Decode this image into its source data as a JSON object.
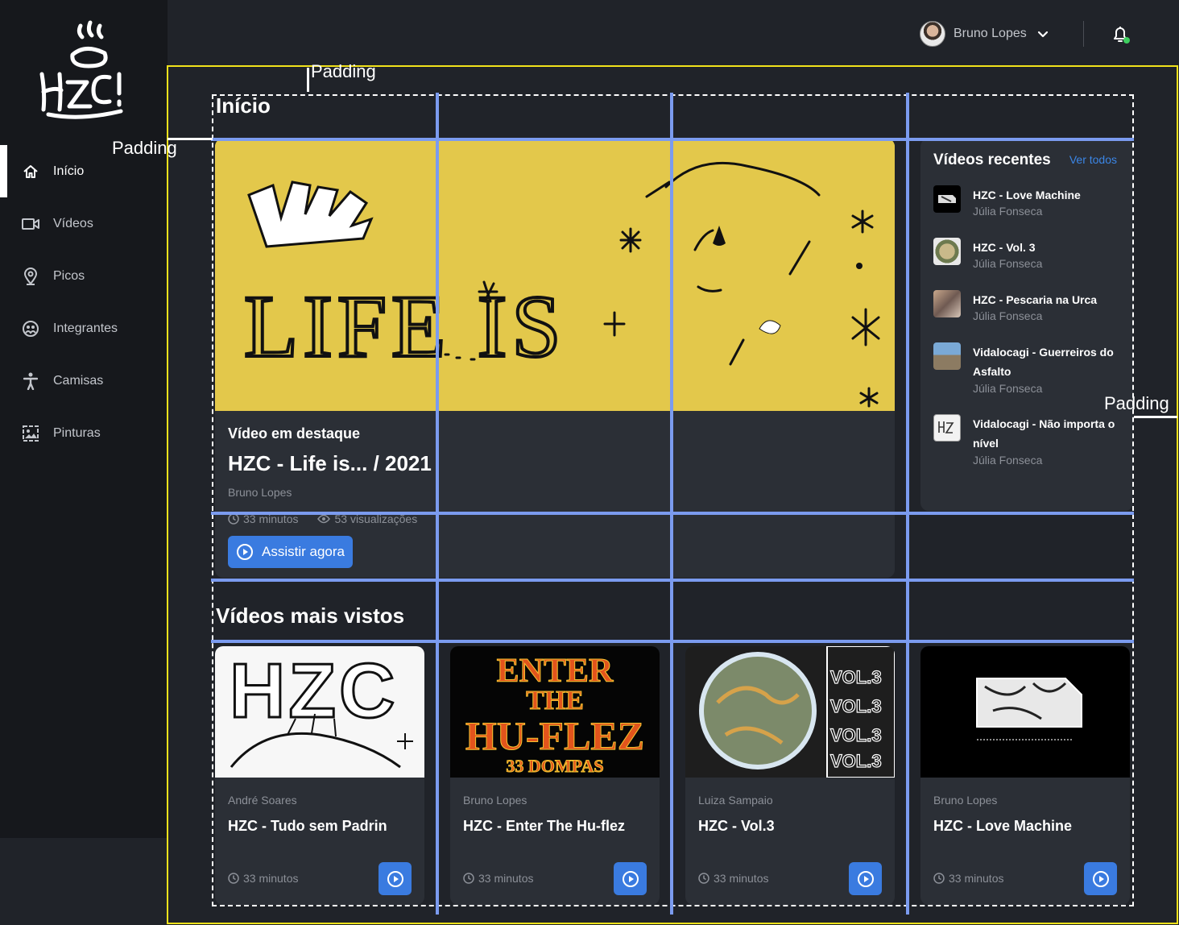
{
  "sidebar": {
    "logo_alt": "HZC",
    "items": [
      {
        "label": "Início",
        "icon": "home-icon",
        "active": true
      },
      {
        "label": "Vídeos",
        "icon": "video-camera-icon"
      },
      {
        "label": "Picos",
        "icon": "map-pin-icon"
      },
      {
        "label": "Integrantes",
        "icon": "users-icon"
      },
      {
        "label": "Camisas",
        "icon": "person-icon"
      },
      {
        "label": "Pinturas",
        "icon": "image-frame-icon"
      }
    ]
  },
  "header": {
    "user_name": "Bruno Lopes",
    "notification_indicator_color": "#3ecf5f"
  },
  "annotations": {
    "padding_top": "Padding",
    "padding_left": "Padding",
    "padding_right": "Padding"
  },
  "home": {
    "title": "Início",
    "featured": {
      "kicker": "Vídeo em destaque",
      "title": "HZC - Life is... / 2021",
      "author": "Bruno Lopes",
      "duration": "33 minutos",
      "views": "53 visualizações",
      "cta": "Assistir agora"
    },
    "recent": {
      "title": "Vídeos recentes",
      "see_all": "Ver todos",
      "items": [
        {
          "title": "HZC - Love Machine",
          "author": "Júlia Fonseca"
        },
        {
          "title": "HZC - Vol. 3",
          "author": "Júlia Fonseca"
        },
        {
          "title": "HZC - Pescaria na Urca",
          "author": "Júlia Fonseca"
        },
        {
          "title": "Vidalocagi - Guerreiros do Asfalto",
          "author": "Júlia Fonseca"
        },
        {
          "title": "Vidalocagi - Não importa o nível",
          "author": "Júlia Fonseca"
        }
      ]
    },
    "most_viewed": {
      "title": "Vídeos mais vistos",
      "items": [
        {
          "author": "André Soares",
          "title": "HZC - Tudo sem Padrin",
          "duration": "33 minutos"
        },
        {
          "author": "Bruno Lopes",
          "title": "HZC - Enter The Hu-flez",
          "duration": "33 minutos"
        },
        {
          "author": "Luiza Sampaio",
          "title": "HZC - Vol.3",
          "duration": "33 minutos"
        },
        {
          "author": "Bruno Lopes",
          "title": "HZC - Love Machine",
          "duration": "33 minutos"
        }
      ]
    }
  },
  "thumb_text": {
    "featured_line": "LIFE IS",
    "card1": "HZC",
    "card2_l1": "ENTER",
    "card2_l2": "THE",
    "card2_l3": "HU-FLEZ",
    "card2_l4": "33 DOMPAS",
    "card3": "VOL.3"
  },
  "colors": {
    "accent": "#3a7be0",
    "link": "#3b86e6",
    "featured_bg": "#e3c84b",
    "guide_blue": "#7b9bef",
    "frame_yellow": "#f2e21b"
  }
}
